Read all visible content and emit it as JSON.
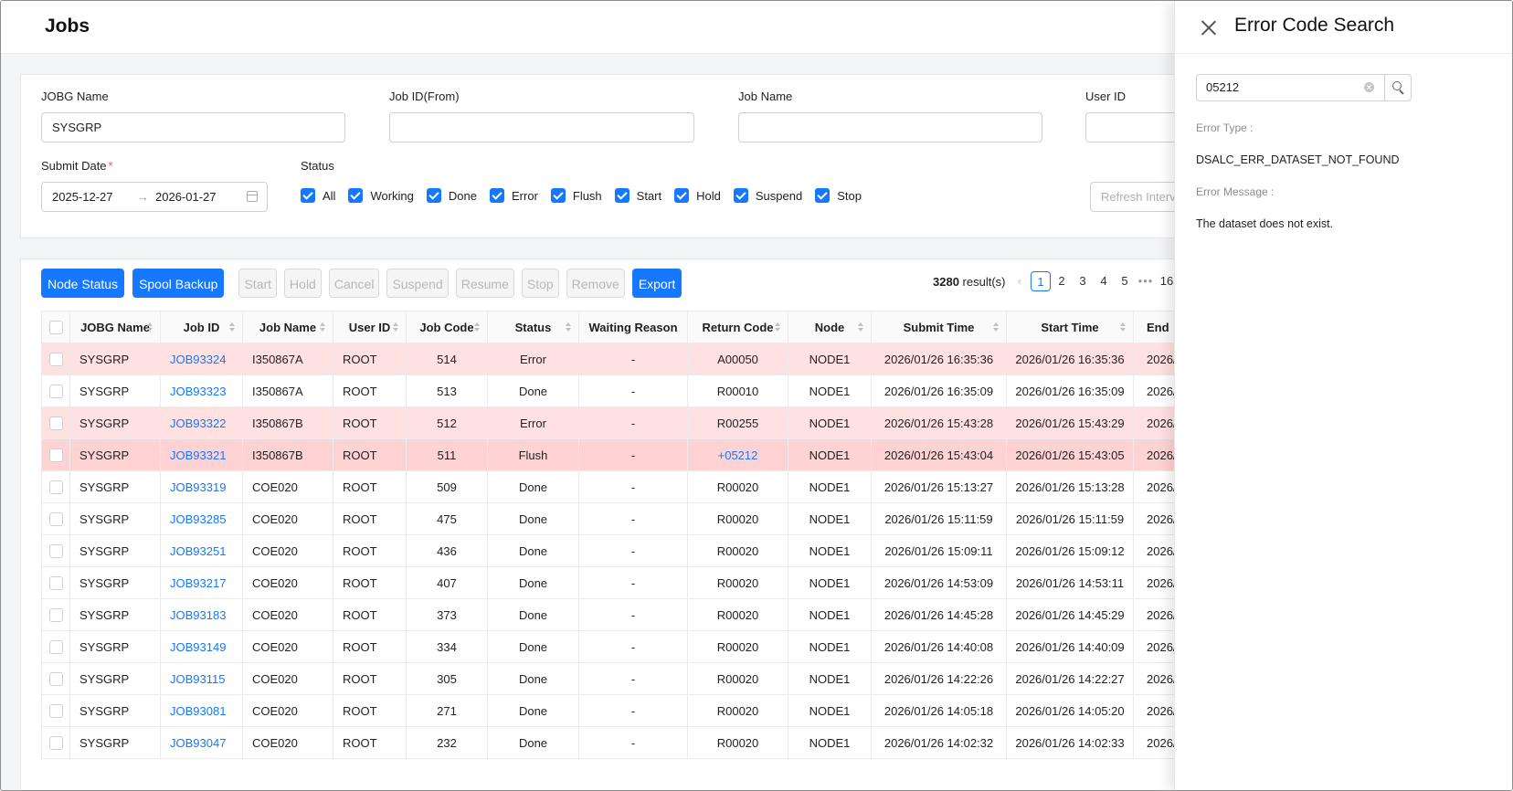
{
  "page": {
    "title": "Jobs"
  },
  "filters": {
    "jobg_name_label": "JOBG Name",
    "jobg_name_value": "SYSGRP",
    "job_id_from_label": "Job ID(From)",
    "job_id_from_value": "",
    "job_name_label": "Job Name",
    "job_name_value": "",
    "user_id_label": "User ID",
    "user_id_value": "",
    "submit_date_label": "Submit Date",
    "submit_date_required": "*",
    "submit_date_from": "2025-12-27",
    "submit_date_arrow": "→",
    "submit_date_to": "2026-01-27",
    "status_label": "Status",
    "status_options": [
      "All",
      "Working",
      "Done",
      "Error",
      "Flush",
      "Start",
      "Hold",
      "Suspend",
      "Stop"
    ],
    "refresh_interval_placeholder": "Refresh Interval"
  },
  "toolbar": {
    "node_status": "Node Status",
    "spool_backup": "Spool Backup",
    "start": "Start",
    "hold": "Hold",
    "cancel": "Cancel",
    "suspend": "Suspend",
    "resume": "Resume",
    "stop": "Stop",
    "remove": "Remove",
    "export": "Export"
  },
  "results": {
    "count": "3280",
    "suffix": " result(s)"
  },
  "pagination": {
    "prev": "‹",
    "pages": [
      "1",
      "2",
      "3",
      "4",
      "5"
    ],
    "active": "1",
    "dots": "•••",
    "last": "16"
  },
  "table": {
    "columns": [
      "JOBG Name",
      "Job ID",
      "Job Name",
      "User ID",
      "Job Code",
      "Status",
      "Waiting Reason",
      "Return Code",
      "Node",
      "Submit Time",
      "Start Time",
      "End"
    ],
    "truncated_cell": "2026/",
    "rows": [
      {
        "jobg": "SYSGRP",
        "job_id": "JOB93324",
        "job_name": "I350867A",
        "user": "ROOT",
        "code": "514",
        "status": "Error",
        "wait": "-",
        "ret": "A00050",
        "node": "NODE1",
        "submit": "2026/01/26 16:35:36",
        "start": "2026/01/26 16:35:36"
      },
      {
        "jobg": "SYSGRP",
        "job_id": "JOB93323",
        "job_name": "I350867A",
        "user": "ROOT",
        "code": "513",
        "status": "Done",
        "wait": "-",
        "ret": "R00010",
        "node": "NODE1",
        "submit": "2026/01/26 16:35:09",
        "start": "2026/01/26 16:35:09"
      },
      {
        "jobg": "SYSGRP",
        "job_id": "JOB93322",
        "job_name": "I350867B",
        "user": "ROOT",
        "code": "512",
        "status": "Error",
        "wait": "-",
        "ret": "R00255",
        "node": "NODE1",
        "submit": "2026/01/26 15:43:28",
        "start": "2026/01/26 15:43:29"
      },
      {
        "jobg": "SYSGRP",
        "job_id": "JOB93321",
        "job_name": "I350867B",
        "user": "ROOT",
        "code": "511",
        "status": "Flush",
        "wait": "-",
        "ret": "+05212",
        "node": "NODE1",
        "submit": "2026/01/26 15:43:04",
        "start": "2026/01/26 15:43:05"
      },
      {
        "jobg": "SYSGRP",
        "job_id": "JOB93319",
        "job_name": "COE020",
        "user": "ROOT",
        "code": "509",
        "status": "Done",
        "wait": "-",
        "ret": "R00020",
        "node": "NODE1",
        "submit": "2026/01/26 15:13:27",
        "start": "2026/01/26 15:13:28"
      },
      {
        "jobg": "SYSGRP",
        "job_id": "JOB93285",
        "job_name": "COE020",
        "user": "ROOT",
        "code": "475",
        "status": "Done",
        "wait": "-",
        "ret": "R00020",
        "node": "NODE1",
        "submit": "2026/01/26 15:11:59",
        "start": "2026/01/26 15:11:59"
      },
      {
        "jobg": "SYSGRP",
        "job_id": "JOB93251",
        "job_name": "COE020",
        "user": "ROOT",
        "code": "436",
        "status": "Done",
        "wait": "-",
        "ret": "R00020",
        "node": "NODE1",
        "submit": "2026/01/26 15:09:11",
        "start": "2026/01/26 15:09:12"
      },
      {
        "jobg": "SYSGRP",
        "job_id": "JOB93217",
        "job_name": "COE020",
        "user": "ROOT",
        "code": "407",
        "status": "Done",
        "wait": "-",
        "ret": "R00020",
        "node": "NODE1",
        "submit": "2026/01/26 14:53:09",
        "start": "2026/01/26 14:53:11"
      },
      {
        "jobg": "SYSGRP",
        "job_id": "JOB93183",
        "job_name": "COE020",
        "user": "ROOT",
        "code": "373",
        "status": "Done",
        "wait": "-",
        "ret": "R00020",
        "node": "NODE1",
        "submit": "2026/01/26 14:45:28",
        "start": "2026/01/26 14:45:29"
      },
      {
        "jobg": "SYSGRP",
        "job_id": "JOB93149",
        "job_name": "COE020",
        "user": "ROOT",
        "code": "334",
        "status": "Done",
        "wait": "-",
        "ret": "R00020",
        "node": "NODE1",
        "submit": "2026/01/26 14:40:08",
        "start": "2026/01/26 14:40:09"
      },
      {
        "jobg": "SYSGRP",
        "job_id": "JOB93115",
        "job_name": "COE020",
        "user": "ROOT",
        "code": "305",
        "status": "Done",
        "wait": "-",
        "ret": "R00020",
        "node": "NODE1",
        "submit": "2026/01/26 14:22:26",
        "start": "2026/01/26 14:22:27"
      },
      {
        "jobg": "SYSGRP",
        "job_id": "JOB93081",
        "job_name": "COE020",
        "user": "ROOT",
        "code": "271",
        "status": "Done",
        "wait": "-",
        "ret": "R00020",
        "node": "NODE1",
        "submit": "2026/01/26 14:05:18",
        "start": "2026/01/26 14:05:20"
      },
      {
        "jobg": "SYSGRP",
        "job_id": "JOB93047",
        "job_name": "COE020",
        "user": "ROOT",
        "code": "232",
        "status": "Done",
        "wait": "-",
        "ret": "R00020",
        "node": "NODE1",
        "submit": "2026/01/26 14:02:32",
        "start": "2026/01/26 14:02:33"
      }
    ]
  },
  "drawer": {
    "title": "Error Code Search",
    "search_value": "05212",
    "error_type_label": "Error Type :",
    "error_type_value": "DSALC_ERR_DATASET_NOT_FOUND",
    "error_message_label": "Error Message :",
    "error_message_value": "The dataset does not exist."
  },
  "colors": {
    "accent": "#1677ff",
    "error_row": "#ffe1e1",
    "flush_row": "#ffd3d3",
    "required": "#ff4d4f"
  },
  "icons": [
    "close-icon",
    "search-icon",
    "clear-icon",
    "calendar-icon",
    "sort-icon",
    "checkbox-checked-icon"
  ]
}
